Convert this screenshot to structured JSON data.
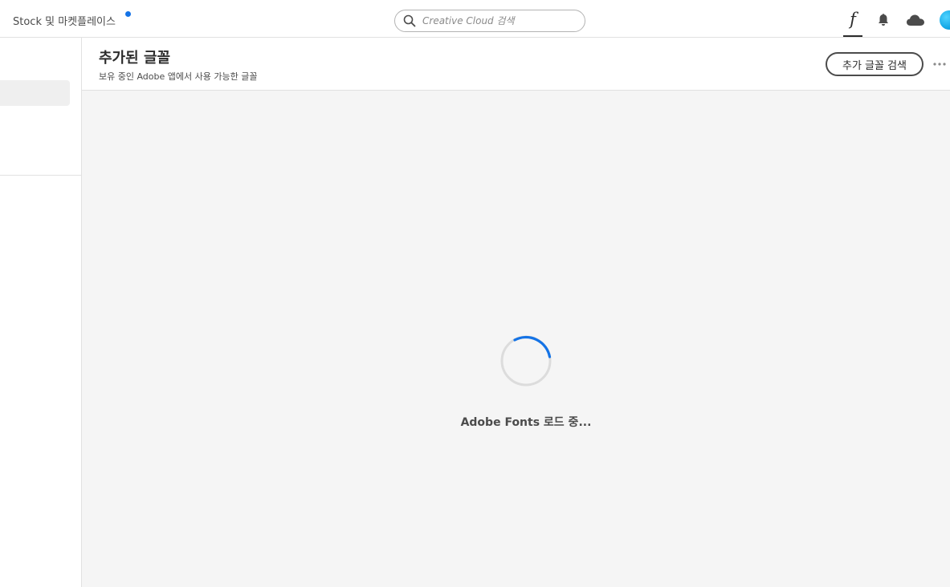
{
  "topbar": {
    "stock_label": "Stock 및 마켓플레이스",
    "search_placeholder": "Creative Cloud 검색",
    "search_value": "",
    "fonts_glyph": "f",
    "icons": [
      "search-icon",
      "fonts-icon",
      "bell-icon",
      "cloud-icon"
    ]
  },
  "colors": {
    "accent": "#1473e6",
    "avatar": "#13a8e6",
    "background": "#f5f5f5"
  },
  "header": {
    "title": "추가된 글꼴",
    "subtitle": "보유 중인 Adobe 앱에서 사용 가능한 글꼴",
    "find_more_label": "추가 글꼴 검색"
  },
  "main": {
    "loading_text": "Adobe Fonts 로드 중..."
  }
}
